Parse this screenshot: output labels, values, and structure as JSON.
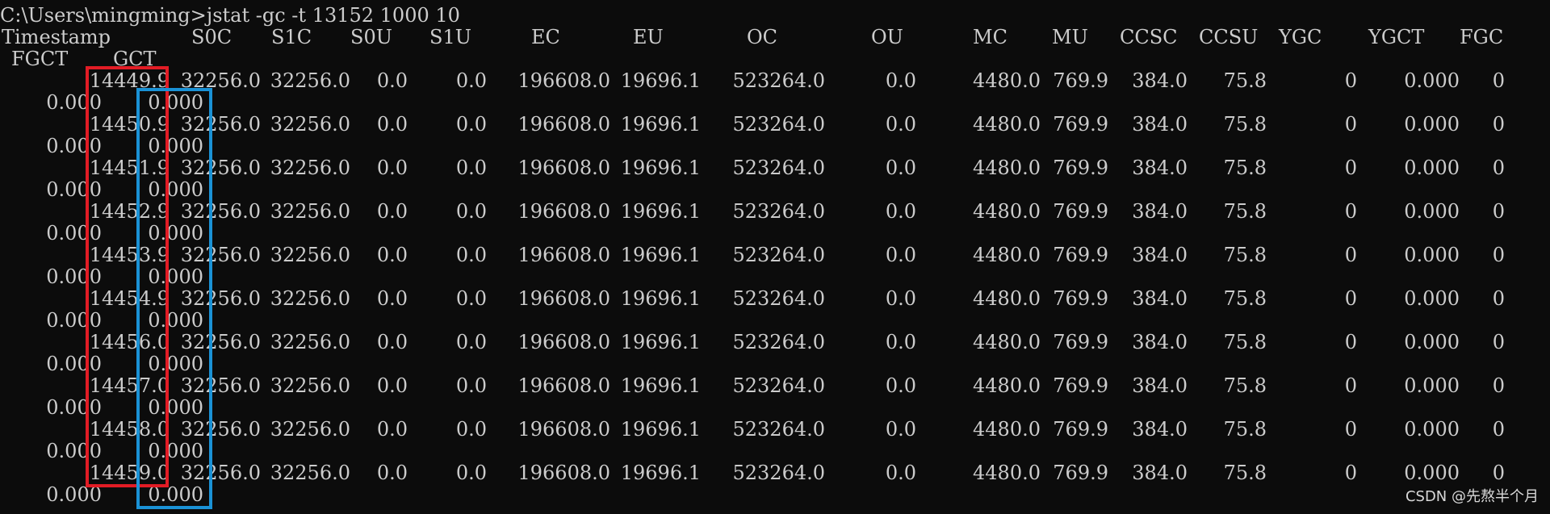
{
  "terminal": {
    "command_line": "C:\\Users\\mingming>jstat -gc -t 13152 1000 10",
    "headers": [
      "Timestamp",
      "S0C",
      "S1C",
      "S0U",
      "S1U",
      "EC",
      "EU",
      "OC",
      "OU",
      "MC",
      "MU",
      "CCSC",
      "CCSU",
      "YGC",
      "YGCT",
      "FGC"
    ],
    "headers_wrapped": [
      "FGCT",
      "GCT"
    ],
    "rows": [
      {
        "ts": "14449.9",
        "s0c": "32256.0",
        "s1c": "32256.0",
        "s0u": "0.0",
        "s1u": "0.0",
        "ec": "196608.0",
        "eu": "19696.1",
        "oc": "523264.0",
        "ou": "0.0",
        "mc": "4480.0",
        "mu": "769.9",
        "ccsc": "384.0",
        "ccsu": "75.8",
        "ygc": "0",
        "ygct": "0.000",
        "fgc": "0",
        "fgct": "0.000",
        "gct": "0.000"
      },
      {
        "ts": "14450.9",
        "s0c": "32256.0",
        "s1c": "32256.0",
        "s0u": "0.0",
        "s1u": "0.0",
        "ec": "196608.0",
        "eu": "19696.1",
        "oc": "523264.0",
        "ou": "0.0",
        "mc": "4480.0",
        "mu": "769.9",
        "ccsc": "384.0",
        "ccsu": "75.8",
        "ygc": "0",
        "ygct": "0.000",
        "fgc": "0",
        "fgct": "0.000",
        "gct": "0.000"
      },
      {
        "ts": "14451.9",
        "s0c": "32256.0",
        "s1c": "32256.0",
        "s0u": "0.0",
        "s1u": "0.0",
        "ec": "196608.0",
        "eu": "19696.1",
        "oc": "523264.0",
        "ou": "0.0",
        "mc": "4480.0",
        "mu": "769.9",
        "ccsc": "384.0",
        "ccsu": "75.8",
        "ygc": "0",
        "ygct": "0.000",
        "fgc": "0",
        "fgct": "0.000",
        "gct": "0.000"
      },
      {
        "ts": "14452.9",
        "s0c": "32256.0",
        "s1c": "32256.0",
        "s0u": "0.0",
        "s1u": "0.0",
        "ec": "196608.0",
        "eu": "19696.1",
        "oc": "523264.0",
        "ou": "0.0",
        "mc": "4480.0",
        "mu": "769.9",
        "ccsc": "384.0",
        "ccsu": "75.8",
        "ygc": "0",
        "ygct": "0.000",
        "fgc": "0",
        "fgct": "0.000",
        "gct": "0.000"
      },
      {
        "ts": "14453.9",
        "s0c": "32256.0",
        "s1c": "32256.0",
        "s0u": "0.0",
        "s1u": "0.0",
        "ec": "196608.0",
        "eu": "19696.1",
        "oc": "523264.0",
        "ou": "0.0",
        "mc": "4480.0",
        "mu": "769.9",
        "ccsc": "384.0",
        "ccsu": "75.8",
        "ygc": "0",
        "ygct": "0.000",
        "fgc": "0",
        "fgct": "0.000",
        "gct": "0.000"
      },
      {
        "ts": "14454.9",
        "s0c": "32256.0",
        "s1c": "32256.0",
        "s0u": "0.0",
        "s1u": "0.0",
        "ec": "196608.0",
        "eu": "19696.1",
        "oc": "523264.0",
        "ou": "0.0",
        "mc": "4480.0",
        "mu": "769.9",
        "ccsc": "384.0",
        "ccsu": "75.8",
        "ygc": "0",
        "ygct": "0.000",
        "fgc": "0",
        "fgct": "0.000",
        "gct": "0.000"
      },
      {
        "ts": "14456.0",
        "s0c": "32256.0",
        "s1c": "32256.0",
        "s0u": "0.0",
        "s1u": "0.0",
        "ec": "196608.0",
        "eu": "19696.1",
        "oc": "523264.0",
        "ou": "0.0",
        "mc": "4480.0",
        "mu": "769.9",
        "ccsc": "384.0",
        "ccsu": "75.8",
        "ygc": "0",
        "ygct": "0.000",
        "fgc": "0",
        "fgct": "0.000",
        "gct": "0.000"
      },
      {
        "ts": "14457.0",
        "s0c": "32256.0",
        "s1c": "32256.0",
        "s0u": "0.0",
        "s1u": "0.0",
        "ec": "196608.0",
        "eu": "19696.1",
        "oc": "523264.0",
        "ou": "0.0",
        "mc": "4480.0",
        "mu": "769.9",
        "ccsc": "384.0",
        "ccsu": "75.8",
        "ygc": "0",
        "ygct": "0.000",
        "fgc": "0",
        "fgct": "0.000",
        "gct": "0.000"
      },
      {
        "ts": "14458.0",
        "s0c": "32256.0",
        "s1c": "32256.0",
        "s0u": "0.0",
        "s1u": "0.0",
        "ec": "196608.0",
        "eu": "19696.1",
        "oc": "523264.0",
        "ou": "0.0",
        "mc": "4480.0",
        "mu": "769.9",
        "ccsc": "384.0",
        "ccsu": "75.8",
        "ygc": "0",
        "ygct": "0.000",
        "fgc": "0",
        "fgct": "0.000",
        "gct": "0.000"
      },
      {
        "ts": "14459.0",
        "s0c": "32256.0",
        "s1c": "32256.0",
        "s0u": "0.0",
        "s1u": "0.0",
        "ec": "196608.0",
        "eu": "19696.1",
        "oc": "523264.0",
        "ou": "0.0",
        "mc": "4480.0",
        "mu": "769.9",
        "ccsc": "384.0",
        "ccsu": "75.8",
        "ygc": "0",
        "ygct": "0.000",
        "fgc": "0",
        "fgct": "0.000",
        "gct": "0.000"
      }
    ]
  },
  "watermark": "CSDN @先熬半个月",
  "colors": {
    "background": "#0c0c0c",
    "text": "#cccccc",
    "highlight_red": "#e21c25",
    "highlight_blue": "#1a92d6"
  }
}
